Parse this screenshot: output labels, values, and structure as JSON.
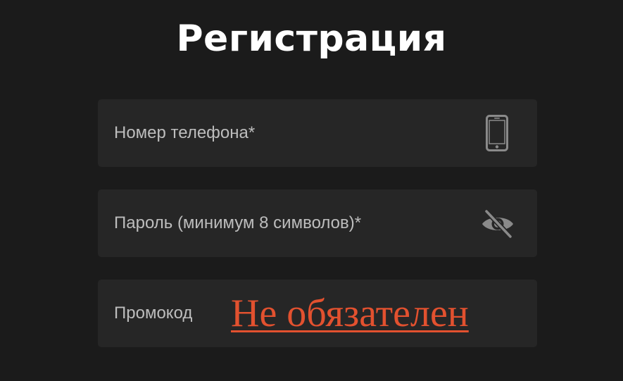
{
  "page": {
    "title": "Регистрация"
  },
  "form": {
    "phone": {
      "placeholder": "Номер телефона*",
      "icon": "phone-icon"
    },
    "password": {
      "placeholder": "Пароль (минимум 8 символов)*",
      "icon": "eye-off-icon"
    },
    "promo": {
      "placeholder": "Промокод",
      "note": "Не обязателен"
    }
  },
  "colors": {
    "background": "#1b1b1b",
    "field_background": "#262626",
    "placeholder_text": "#bdbdbd",
    "icon": "#8a8a8a",
    "accent_note": "#e2512f",
    "title_text": "#ffffff"
  }
}
